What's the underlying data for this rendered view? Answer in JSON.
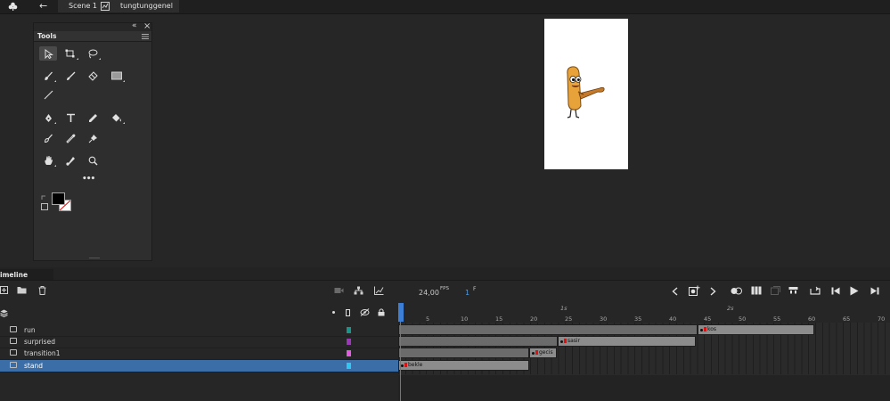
{
  "topbar": {
    "back_label": "←",
    "scene_label": "Scene 1",
    "symbol_label": "tungtunggenel"
  },
  "tools_panel": {
    "title": "Tools",
    "collapse_label": "«",
    "close_label": "×",
    "more_label": "•••"
  },
  "timeline": {
    "tab_label": "imeline",
    "fps_value": "24,00",
    "fps_unit": "FPS",
    "frame_value": "1",
    "frame_unit": "F",
    "ruler_seconds": [
      "1s",
      "2s"
    ],
    "ruler_numbers": [
      "5",
      "10",
      "15",
      "20",
      "25",
      "30",
      "35",
      "40",
      "45",
      "50",
      "55",
      "60",
      "65",
      "70"
    ],
    "layers": [
      {
        "name": "run",
        "color": "#18948a",
        "active": false
      },
      {
        "name": "surprised",
        "color": "#9b38b8",
        "active": false
      },
      {
        "name": "transition1",
        "color": "#e35be0",
        "active": false
      },
      {
        "name": "stand",
        "color": "#2ec7f0",
        "active": true
      }
    ],
    "frame_labels": {
      "run": "kos",
      "surprised": "sasir",
      "transition1": "gecis",
      "stand": "bekle"
    }
  },
  "colors": {
    "accent": "#3b6ea6",
    "playhead": "#3d7fd6"
  }
}
